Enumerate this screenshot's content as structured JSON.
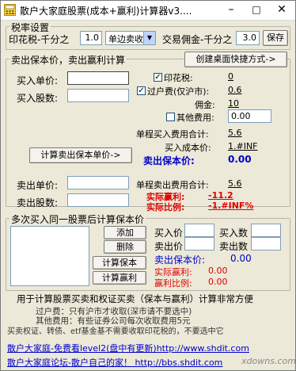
{
  "window": {
    "title": "散户大家庭股票(成本+赢利)计算器v3....",
    "minimize": "–",
    "maximize": "□",
    "close": "✕"
  },
  "tax_settings": {
    "legend": "税率设置",
    "stamp_label": "印花税-千分之",
    "stamp_value": "1.0",
    "mode_value": "单边卖收",
    "commission_label": "交易佣金-千分之",
    "commission_value": "3.0",
    "save_label": "保存"
  },
  "sell_calc": {
    "legend": "卖出保本价，卖出赢利计算",
    "shortcut_label": "创建桌面快捷方式->",
    "buy_price_label": "买入单价:",
    "buy_shares_label": "买入股数:",
    "buy_price_value": "",
    "buy_shares_value": "",
    "stamp_label": "印花税:",
    "stamp_value": "0",
    "transfer_label": "过户费(仅沪市):",
    "transfer_value": "0.6",
    "commission_label": "佣金:",
    "commission_value": "10",
    "other_fee_label": "其他费用:",
    "other_fee_value": "0.00",
    "single_buy_total_label": "单程买入费用合计:",
    "single_buy_total_value": "5.6",
    "buy_cost_label": "买入成本价:",
    "buy_cost_value": "1.#INF",
    "calc_break_even_label": "计算卖出保本单价->",
    "break_even_label": "卖出保本价:",
    "break_even_value": "0.00",
    "sell_price_label": "卖出单价:",
    "sell_shares_label": "卖出股数:",
    "sell_price_value": "",
    "sell_shares_value": "",
    "single_sell_total_label": "单程卖出费用合计:",
    "single_sell_total_value": "5.6",
    "actual_profit_label": "实际赢利:",
    "actual_profit_value": "-11.2",
    "actual_ratio_label": "实际比例:",
    "actual_ratio_value": "-1.#INF%"
  },
  "multi_buy": {
    "legend": "多次买入同一股票后计算保本价",
    "add_label": "添加",
    "delete_label": "删除",
    "calc_break_even_label": "计算保本",
    "calc_profit_label": "计算赢利",
    "buy_price_label": "买入价",
    "buy_count_label": "买入数",
    "sell_price_label": "卖出价",
    "sell_count_label": "卖出数",
    "break_even_label": "卖出保本价:",
    "break_even_value": "0.00",
    "actual_profit_label": "实际赢利:",
    "actual_profit_value": "0.00",
    "actual_ratio_label": "赢利比例:",
    "actual_ratio_value": "0.00"
  },
  "footer": {
    "headline": "用于计算股票买卖和权证买卖（保本与赢利）计算非常方便",
    "note1": "过户费：只有沪市才收取(深市请不要选中)",
    "note2": "其他费用：有些证券公司每次收取费用5元",
    "note3": "买卖权证、转债、etf基金基不需要收取印花税的，不要选中它",
    "link1": "散户大家庭-免费看level2(盘中有更新)http://www.shdit.com",
    "link2": "散户大家庭论坛-散户自己的家！ http://bbs.shdit.com",
    "watermark": "xdowns.com"
  },
  "colors": {
    "window_bg": "#ece9d8",
    "accent_blue": "#0000cc",
    "accent_red": "#e00000"
  }
}
